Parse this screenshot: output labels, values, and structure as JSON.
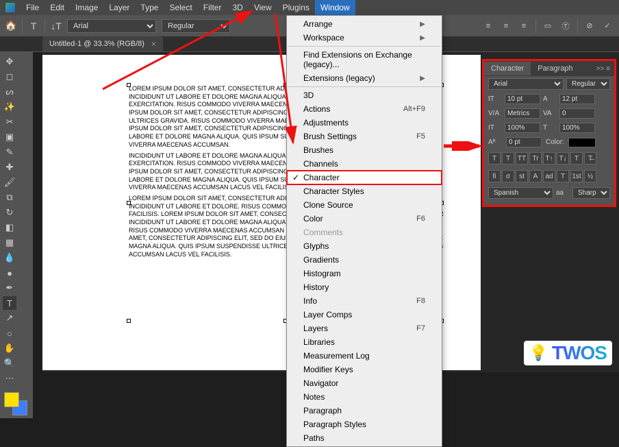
{
  "menubar": [
    "File",
    "Edit",
    "Image",
    "Layer",
    "Type",
    "Select",
    "Filter",
    "3D",
    "View",
    "Plugins",
    "Window"
  ],
  "menubar_open": "Window",
  "optionsbar": {
    "font_family": "Arial",
    "font_style": "Regular"
  },
  "doc_tab": {
    "title": "Untitled-1 @ 33.3% (RGB/8)"
  },
  "dropdown": {
    "items": [
      {
        "label": "Arrange",
        "sub": true
      },
      {
        "label": "Workspace",
        "sub": true
      },
      {
        "sep": true
      },
      {
        "label": "Find Extensions on Exchange (legacy)..."
      },
      {
        "label": "Extensions (legacy)",
        "sub": true
      },
      {
        "sep": true
      },
      {
        "label": "3D"
      },
      {
        "label": "Actions",
        "shortcut": "Alt+F9"
      },
      {
        "label": "Adjustments"
      },
      {
        "label": "Brush Settings",
        "shortcut": "F5"
      },
      {
        "label": "Brushes"
      },
      {
        "label": "Channels"
      },
      {
        "label": "Character",
        "checked": true,
        "highlighted": true
      },
      {
        "label": "Character Styles"
      },
      {
        "label": "Clone Source"
      },
      {
        "label": "Color",
        "shortcut": "F6"
      },
      {
        "label": "Comments",
        "disabled": true
      },
      {
        "label": "Glyphs"
      },
      {
        "label": "Gradients"
      },
      {
        "label": "Histogram"
      },
      {
        "label": "History"
      },
      {
        "label": "Info",
        "shortcut": "F8"
      },
      {
        "label": "Layer Comps"
      },
      {
        "label": "Layers",
        "shortcut": "F7"
      },
      {
        "label": "Libraries"
      },
      {
        "label": "Measurement Log"
      },
      {
        "label": "Modifier Keys"
      },
      {
        "label": "Navigator"
      },
      {
        "label": "Notes"
      },
      {
        "label": "Paragraph"
      },
      {
        "label": "Paragraph Styles"
      },
      {
        "label": "Paths"
      }
    ]
  },
  "char_panel": {
    "tabs": [
      "Character",
      "Paragraph"
    ],
    "active_tab": "Character",
    "font_family": "Arial",
    "font_style": "Regular",
    "font_size": "10 pt",
    "leading": "12 pt",
    "kerning": "Metrics",
    "tracking": "0",
    "vscale": "100%",
    "hscale": "100%",
    "baseline": "0 pt",
    "color_label": "Color:",
    "color": "#000000",
    "language": "Spanish",
    "antialias_label": "aa",
    "antialias": "Sharp",
    "opentype_buttons": [
      "fi",
      "σ",
      "st",
      "A",
      "ad",
      "T",
      "1st",
      "½"
    ],
    "style_buttons": [
      "T",
      "T",
      "TT",
      "Tr",
      "T↑",
      "T↓",
      "T",
      "T̶"
    ]
  },
  "canvas_text": [
    "LOREM IPSUM DOLOR SIT AMET, CONSECTETUR ADIPISCING ELIT, SED DO EIUSMOD TEMPOR INCIDIDUNT UT LABORE ET DOLORE MAGNA ALIQUA. UT ENIM AD MINIM VENIAM, QUIS NOSTRUD EXERCITATION. RISUS COMMODO VIVERRA MAECENAS ACCUMSAN LACUS VEL FACILISIS. LOREM IPSUM DOLOR SIT AMET, CONSECTETUR ADIPISCING ELIT. MAGNA ALIQUA. QUIS IPSUM SUSPENDISSE ULTRICES GRAVIDA. RISUS COMMODO VIVERRA MAECENAS ACCUMSAN LACUS VEL FACILISIS. LOREM IPSUM DOLOR SIT AMET, CONSECTETUR ADIPISCING ELIT, SED DO EIUSMOD TEMPOR INCIDIDUNT UT LABORE ET DOLORE MAGNA ALIQUA. QUIS IPSUM SUSPENDISSE ULTRICES GRAVIDA. RISUS COMMODO VIVERRA MAECENAS ACCUMSAN.",
    "INCIDIDUNT UT LABORE ET DOLORE MAGNA ALIQUA. UT ENIM AD MINIM VENIAM, QUIS NOSTRUD EXERCITATION. RISUS COMMODO VIVERRA MAECENAS ACCUMSAN LACUS VEL FACILISIS. LOREM IPSUM DOLOR SIT AMET, CONSECTETUR ADIPISCING ELIT, SED DO EIUSMOD TEMPOR INCIDIDUNT UT LABORE ET DOLORE MAGNA ALIQUA. QUIS IPSUM SUSPENDISSE ULTRICES GRAVIDA. RISUS COMMODO VIVERRA MAECENAS ACCUMSAN LACUS VEL FACILISIS.",
    "LOREM IPSUM DOLOR SIT AMET, CONSECTETUR ADIPISCING ELIT, SED DO EIUSMOD TEMPOR INCIDIDUNT UT LABORE ET DOLORE. RISUS COMMODO VIVERRA MAECENAS ACCUMSAN LACUS VEL FACILISIS. LOREM IPSUM DOLOR SIT AMET, CONSECTETUR ADIPISCING ELIT, SED DO EIUSMOD TEMPOR INCIDIDUNT UT LABORE ET DOLORE MAGNA ALIQUA. QUIS IPSUM SUSPENDISSE ULTRICES GRAVIDA. RISUS COMMODO VIVERRA MAECENAS ACCUMSAN LACUS VEL FACILISIS. LOREM IPSUM DOLOR SIT AMET, CONSECTETUR ADIPISCING ELIT, SED DO EIUSMOD TEMPOR INCIDIDUNT UT LABORE ET DOLORE MAGNA ALIQUA. QUIS IPSUM SUSPENDISSE ULTRICES GRAVIDA. RISUS COMMODO VIVERRA MAECENAS ACCUMSAN LACUS VEL FACILISIS."
  ],
  "watermark": "TWOS"
}
